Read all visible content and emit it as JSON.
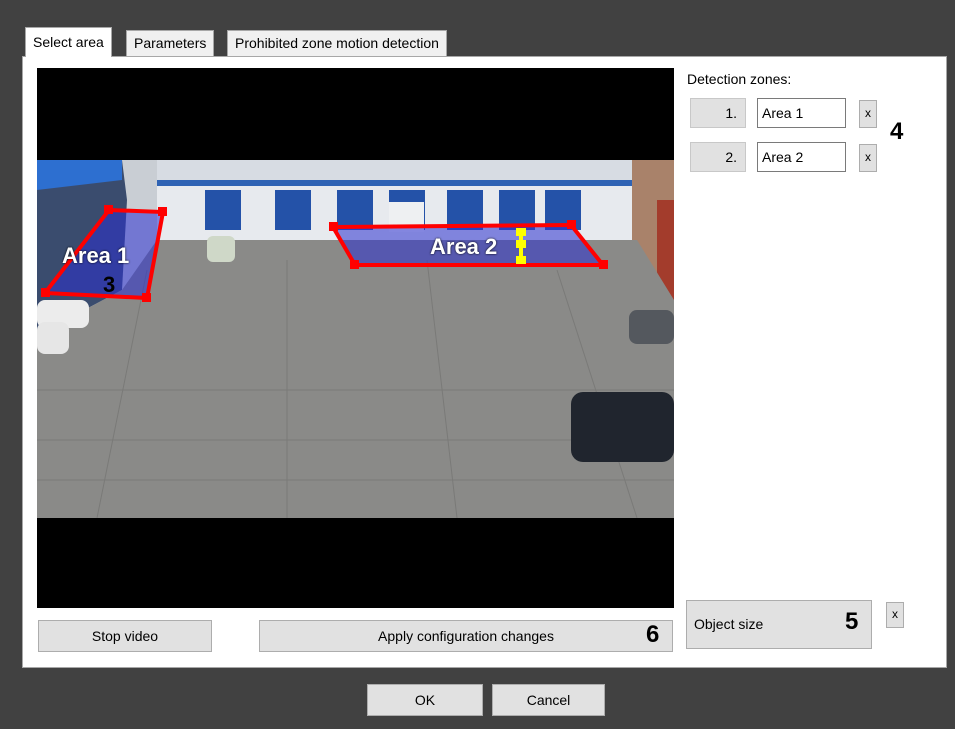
{
  "tabs": [
    {
      "label": "Select area",
      "active": true
    },
    {
      "label": "Parameters",
      "active": false
    },
    {
      "label": "Prohibited zone motion detection",
      "active": false
    }
  ],
  "detection": {
    "title": "Detection zones:",
    "zones": [
      {
        "number": "1.",
        "name": "Area 1",
        "delete_label": "x"
      },
      {
        "number": "2.",
        "name": "Area 2",
        "delete_label": "x"
      }
    ]
  },
  "video_overlay": {
    "area1_label": "Area 1",
    "area2_label": "Area 2",
    "zone_color": "#ff0000",
    "handle_color": "#ffff00"
  },
  "buttons": {
    "stop_video": "Stop video",
    "apply_changes": "Apply configuration changes",
    "object_size": "Object size",
    "object_size_delete": "x",
    "ok": "OK",
    "cancel": "Cancel"
  },
  "callouts": {
    "n3": "3",
    "n4": "4",
    "n5": "5",
    "n6": "6"
  }
}
